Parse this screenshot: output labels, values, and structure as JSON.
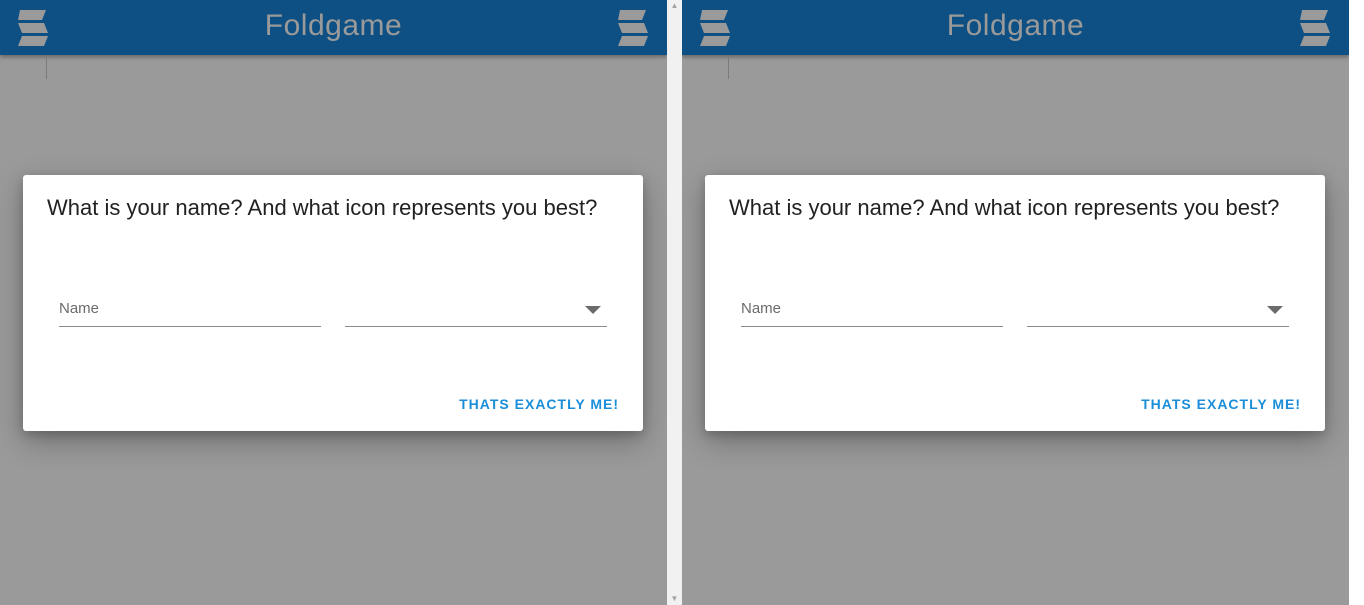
{
  "app": {
    "title": "Foldgame",
    "brand_color": "#0e5083",
    "title_color": "#9a9a9a",
    "scrim_color": "#9a9a9a",
    "menu_icon": "fold-menu-icon"
  },
  "dialog": {
    "title": "What is your name? And what icon represents you best?",
    "name_field": {
      "placeholder": "Name",
      "value": ""
    },
    "icon_select": {
      "value": ""
    },
    "confirm_label": "THATS EXACTLY ME!",
    "accent_color": "#1a8ed8"
  },
  "scrollbar": {
    "up_arrow": "▲",
    "down_arrow": "▼"
  }
}
